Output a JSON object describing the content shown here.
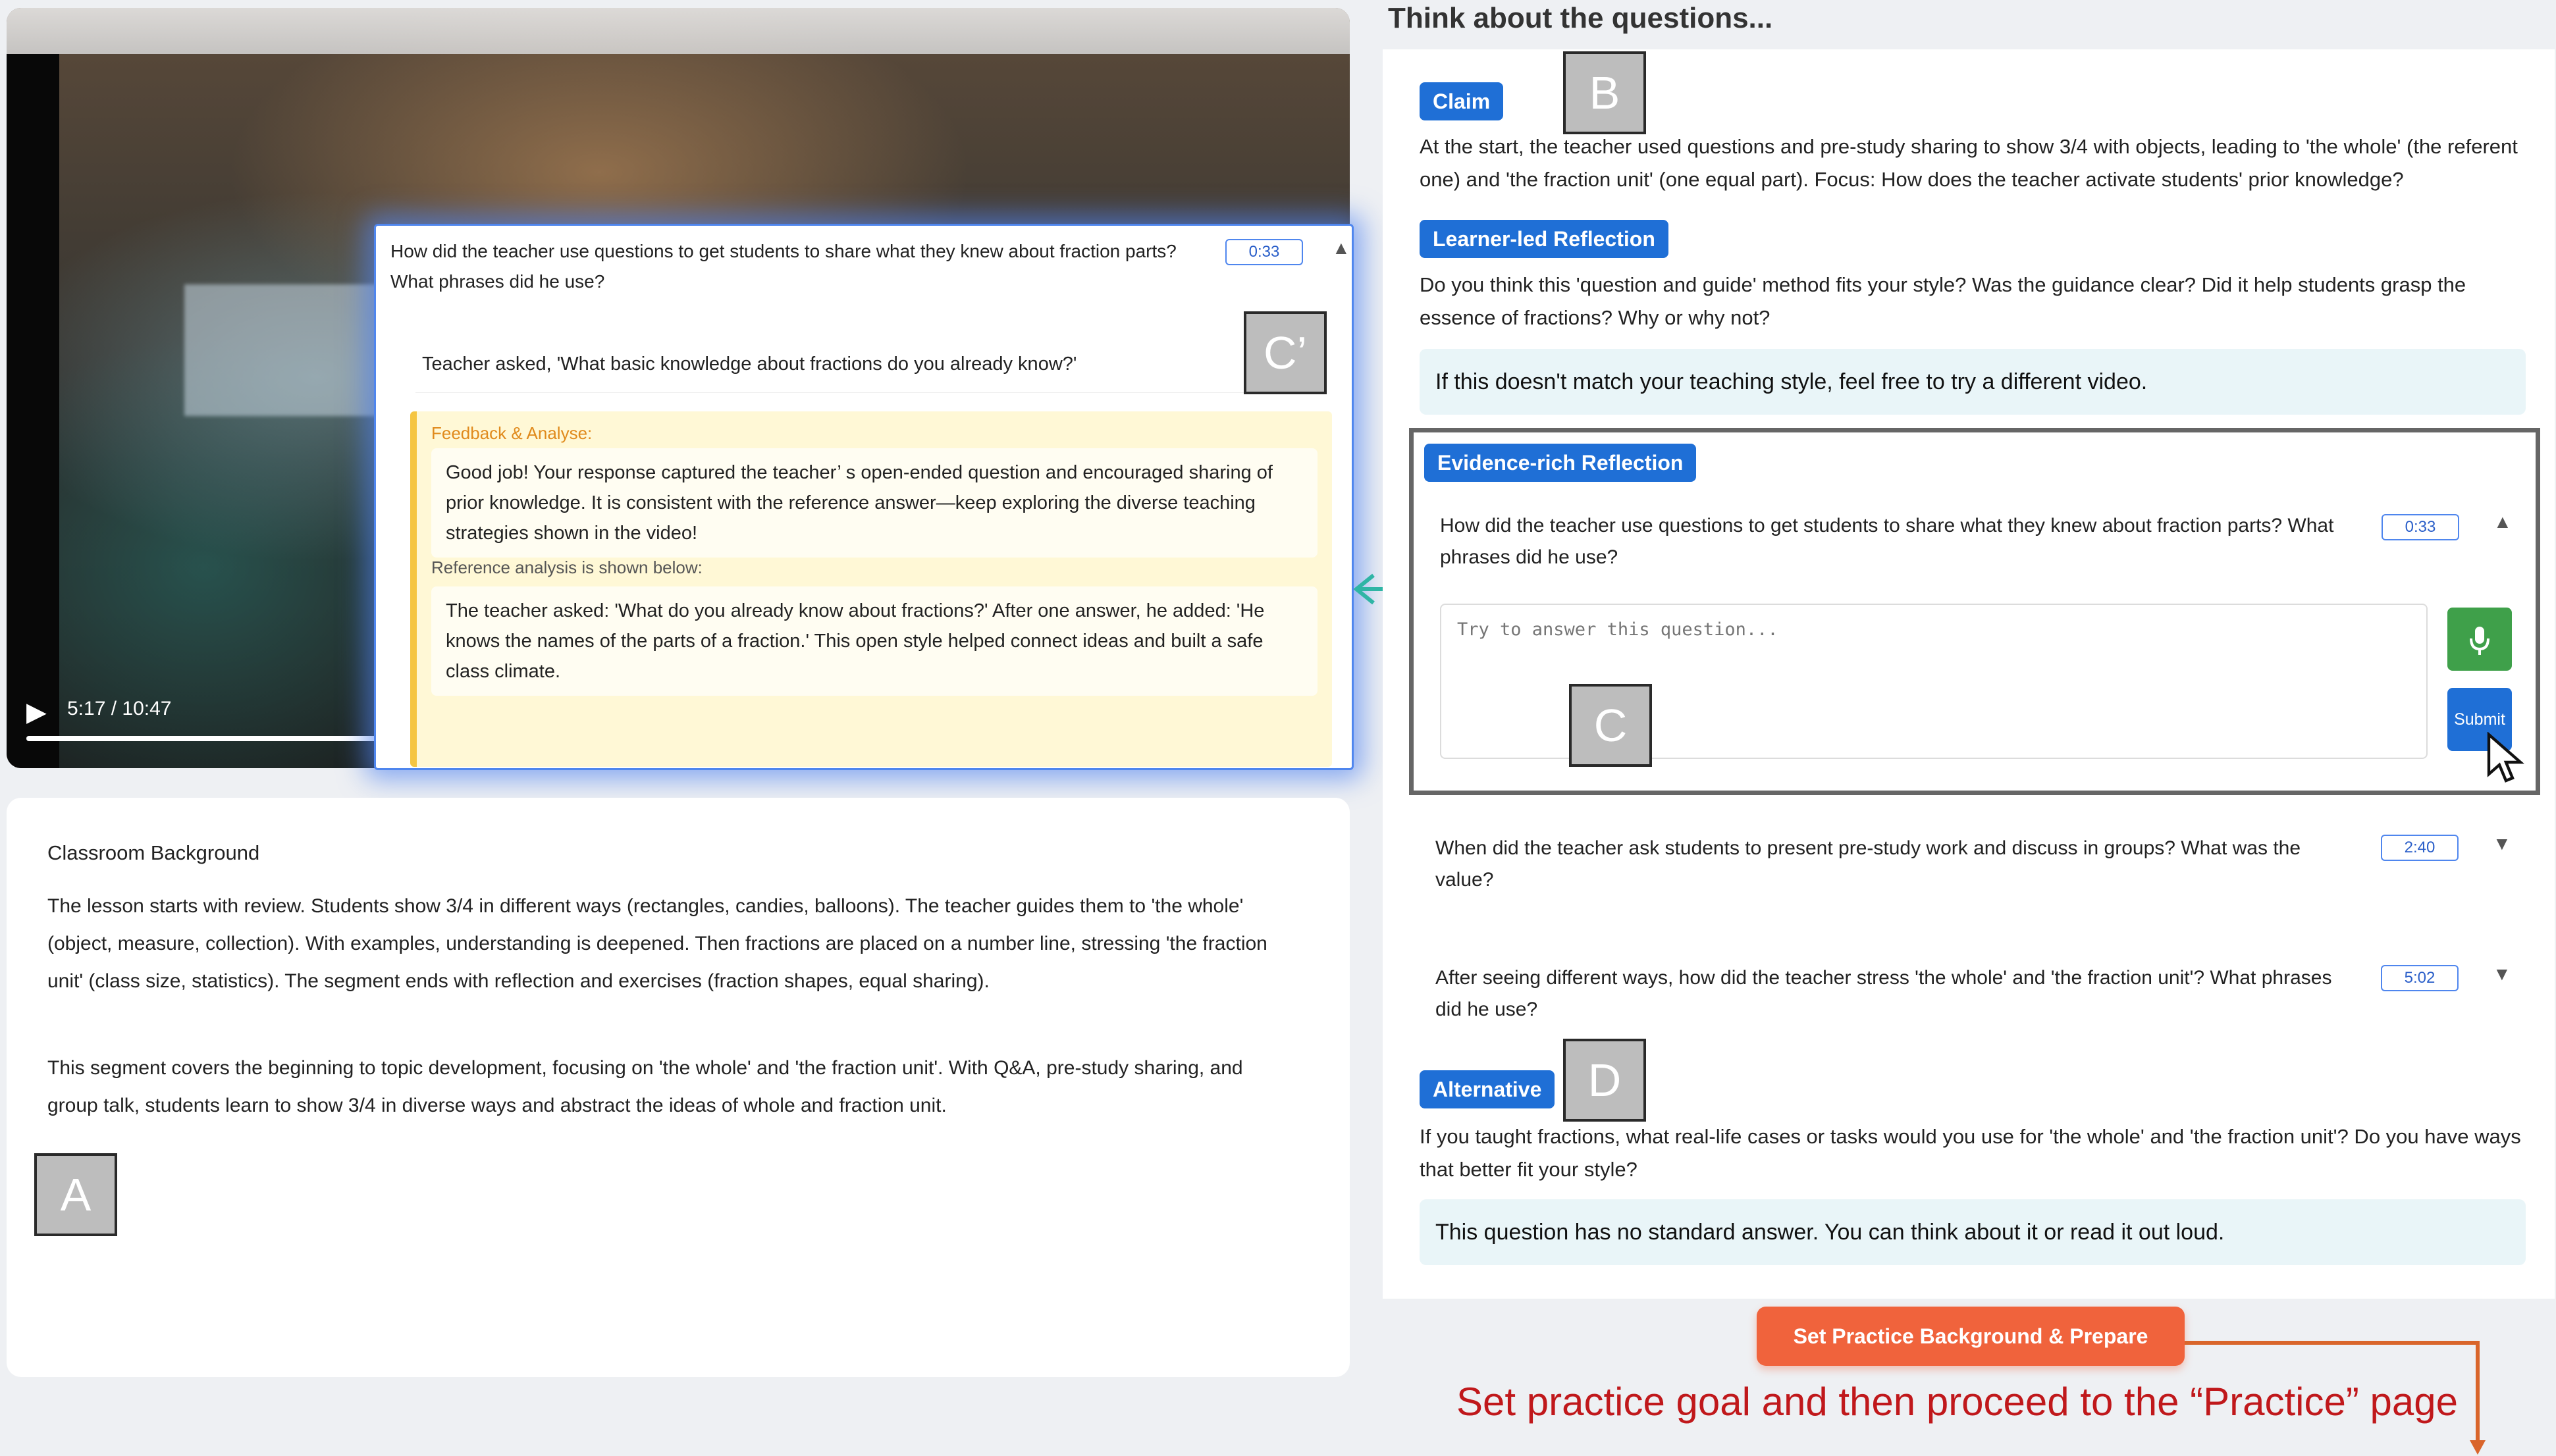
{
  "video": {
    "time_label": "5:17 / 10:47",
    "progress_fraction": 0.49
  },
  "popup": {
    "question": "How did the teacher use questions to get students to share what they knew about fraction parts? What phrases did he use?",
    "timestamp": "0:33",
    "answer": "Teacher asked, 'What basic knowledge about fractions do you already know?'",
    "feedback_title": "Feedback & Analyse:",
    "feedback_text": "Good job! Your response captured the teacher’ s open-ended question and encouraged sharing of prior knowledge. It is consistent with the reference answer—keep exploring the diverse teaching strategies shown in the video!",
    "reference_label": "Reference analysis is shown below:",
    "reference_text": "The teacher asked: 'What do you already know about fractions?' After one answer, he added: 'He knows the names of the parts of a fraction.' This open style helped connect ideas and built a safe class climate."
  },
  "background_card": {
    "title": "Classroom Background",
    "para1": "The lesson starts with review. Students show 3/4 in different ways (rectangles, candies, balloons). The teacher guides them to 'the whole' (object, measure, collection). With examples, understanding is deepened. Then fractions are placed on a number line, stressing 'the fraction unit' (class size, statistics). The segment ends with reflection and exercises (fraction shapes, equal sharing).",
    "para2": "This segment covers the beginning to topic development, focusing on 'the whole' and 'the fraction unit'. With Q&A, pre-study sharing, and group talk, students learn to show 3/4 in diverse ways and abstract the ideas of whole and fraction unit."
  },
  "labels": {
    "a": "A",
    "b": "B",
    "c": "C",
    "c_prime": "C’",
    "d": "D"
  },
  "right": {
    "title": "Think about the questions...",
    "claim_tag": "Claim",
    "claim_text": "At the start, the teacher used questions and pre-study sharing to show 3/4 with objects, leading to 'the whole' (the referent one) and 'the fraction unit' (one equal part). Focus: How does the teacher activate students' prior knowledge?",
    "learner_tag": "Learner-led Reflection",
    "learner_text": "Do you think this 'question and guide' method fits your style? Was the guidance clear? Did it help students grasp the essence of fractions? Why or why not?",
    "learner_note": "If this doesn't match your teaching style, feel free to try a different video.",
    "evidence_tag": "Evidence-rich Reflection",
    "questions": [
      {
        "text": "How did the teacher use questions to get students to share what they knew about fraction parts? What phrases did he use?",
        "time": "0:33"
      },
      {
        "text": "When did the teacher ask students to present pre-study work and discuss in groups? What was the value?",
        "time": "2:40"
      },
      {
        "text": "After seeing different ways, how did the teacher stress 'the whole' and 'the fraction unit'? What phrases did he use?",
        "time": "5:02"
      }
    ],
    "answer_placeholder": "Try to answer this question...",
    "submit_label": "Submit",
    "alternative_tag": "Alternative",
    "alternative_text": "If you taught fractions, what real-life cases or tasks would you use for 'the whole' and 'the fraction unit'? Do you have ways that better fit your style?",
    "alternative_note": "This question has no standard answer. You can think about it or read it out loud."
  },
  "prepare_button": "Set Practice Background & Prepare",
  "caption": "Set practice goal and then proceed to the “Practice” page",
  "colors": {
    "tag_blue": "#1f6fd6",
    "prepare_orange": "#f0633c",
    "caption_red": "#c0181b",
    "arrow_teal": "#2fb5a5",
    "arrow_orange": "#d9652b",
    "mic_green": "#3fa04a"
  }
}
